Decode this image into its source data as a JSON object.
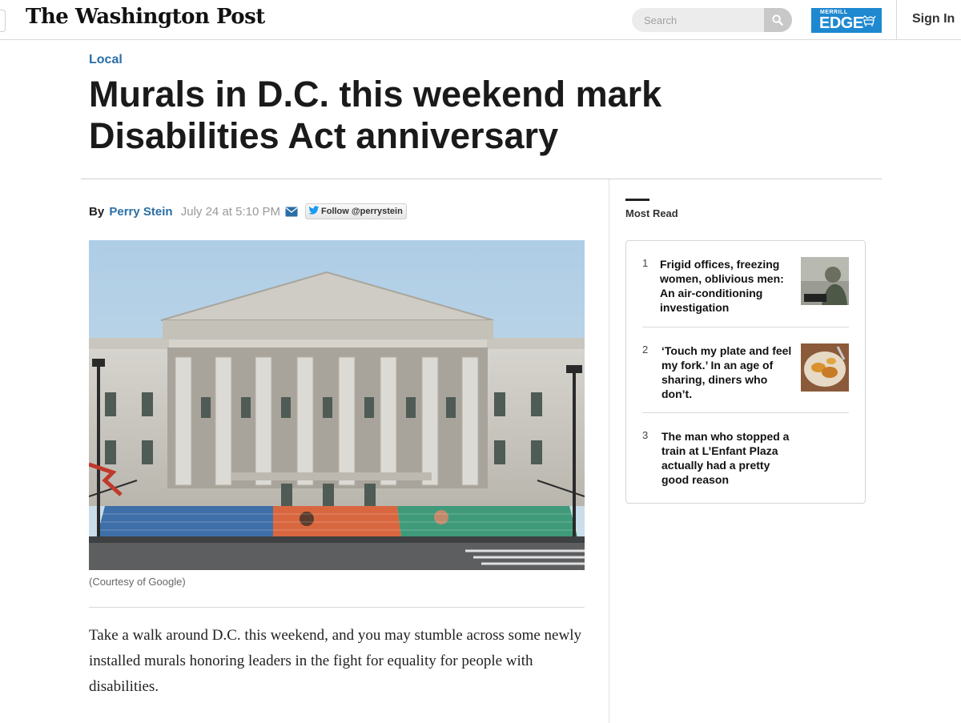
{
  "header": {
    "logo": "The Washington Post",
    "search_placeholder": "Search",
    "ad": {
      "small": "MERRILL",
      "big": "EDGE"
    },
    "sign_in": "Sign In"
  },
  "article": {
    "section": "Local",
    "headline": "Murals in D.C. this weekend mark Disabilities Act anniversary",
    "by": "By",
    "author": "Perry Stein",
    "date": "July 24 at 5:10 PM",
    "follow": "Follow @perrystein",
    "caption": "(Courtesy of Google)",
    "body": "Take a walk around D.C. this weekend, and you may stumble across some newly installed murals honoring leaders in the fight for equality for people with disabilities."
  },
  "most_read": {
    "title": "Most Read",
    "items": [
      {
        "num": "1",
        "text": "Frigid offices, freezing women, oblivious men: An air-conditioning investigation"
      },
      {
        "num": "2",
        "text": "‘Touch my plate and feel my fork.’ In an age of sharing, diners who don’t."
      },
      {
        "num": "3",
        "text": "The man who stopped a train at L’Enfant Plaza actually had a pretty good reason"
      }
    ]
  },
  "colors": {
    "link_blue": "#2a6ea6",
    "ad_blue": "#1e88d0"
  }
}
